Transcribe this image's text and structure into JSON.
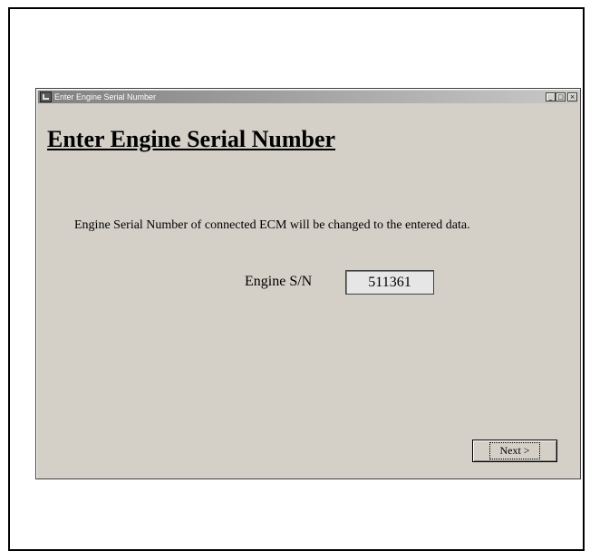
{
  "window": {
    "title": "Enter Engine Serial Number",
    "controls": {
      "minimize": "_",
      "maximize": "□",
      "close": "×"
    }
  },
  "main": {
    "heading": "Enter Engine Serial Number",
    "description": "Engine Serial Number of connected ECM will be changed to the entered data.",
    "serial_label": "Engine S/N",
    "serial_value": "511361",
    "next_label": "Next >"
  }
}
